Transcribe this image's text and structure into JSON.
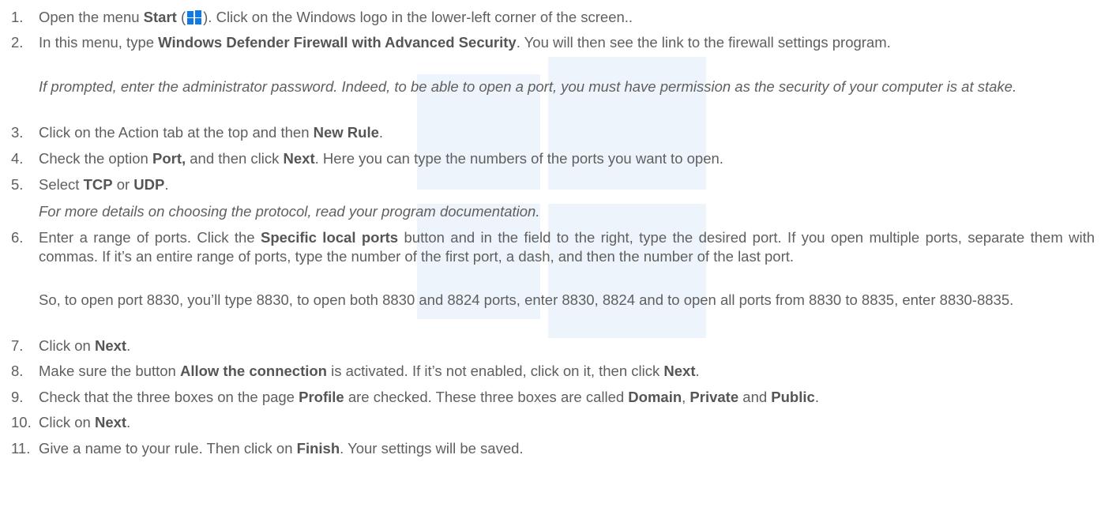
{
  "steps": [
    {
      "num": "1.",
      "parts": [
        "Open the menu ",
        {
          "b": "Start"
        },
        " (",
        {
          "icon": "windows"
        },
        "). Click on the Windows logo in the lower-left corner of the screen.."
      ]
    },
    {
      "num": "2.",
      "parts": [
        "In this menu, type ",
        {
          "b": "Windows Defender Firewall with Advanced Security"
        },
        ". You will then see the link to the firewall settings program."
      ]
    },
    {
      "num": "3.",
      "parts": [
        "Click on the Action tab at the top and then ",
        {
          "b": "New Rule"
        },
        "."
      ]
    },
    {
      "num": "4.",
      "parts": [
        "Check the option ",
        {
          "b": "Port,"
        },
        " and then click ",
        {
          "b": "Next"
        },
        ". Here you can type the numbers of the ports you want to open."
      ]
    },
    {
      "num": "5.",
      "parts": [
        "Select ",
        {
          "b": "TCP"
        },
        " or ",
        {
          "b": "UDP"
        },
        "."
      ]
    },
    {
      "num": "6.",
      "parts": [
        "Enter a range of ports. Click the ",
        {
          "b": "Specific local ports"
        },
        " button and in the field to the right, type the desired port. If you open multiple ports, separate them with commas. If it’s an entire range of ports, type the number of the first port, a dash, and then the number of the last port."
      ]
    },
    {
      "num": "7.",
      "parts": [
        "Click on ",
        {
          "b": "Next"
        },
        "."
      ]
    },
    {
      "num": "8.",
      "parts": [
        "Make sure the button ",
        {
          "b": "Allow the connection"
        },
        " is activated. If it’s not enabled, click on it, then click ",
        {
          "b": "Next"
        },
        "."
      ]
    },
    {
      "num": "9.",
      "parts": [
        "Check that the three boxes on the page ",
        {
          "b": "Profile"
        },
        " are checked. These three boxes are called ",
        {
          "b": "Domain"
        },
        ", ",
        {
          "b": "Private"
        },
        " and ",
        {
          "b": "Public"
        },
        "."
      ]
    },
    {
      "num": "10.",
      "parts": [
        "Click on ",
        {
          "b": "Next"
        },
        "."
      ]
    },
    {
      "num": "11.",
      "parts": [
        "Give a name to your rule. Then click on ",
        {
          "b": "Finish"
        },
        ". Your settings will be saved."
      ]
    }
  ],
  "notes": {
    "admin_prompt": "If prompted, enter the administrator password. Indeed, to be able to open a port, you must have permission as the security of your computer is at stake.",
    "protocol": "For more details on choosing the protocol, read your program documentation.",
    "example": "So, to open port 8830, you’ll type 8830, to open both 8830 and 8824 ports, enter 8830, 8824 and to open all ports from 8830 to 8835, enter 8830-8835."
  },
  "colors": {
    "text": "#5f5f5f",
    "windows_logo": "#1179e6",
    "watermark": "#eef4fb"
  }
}
